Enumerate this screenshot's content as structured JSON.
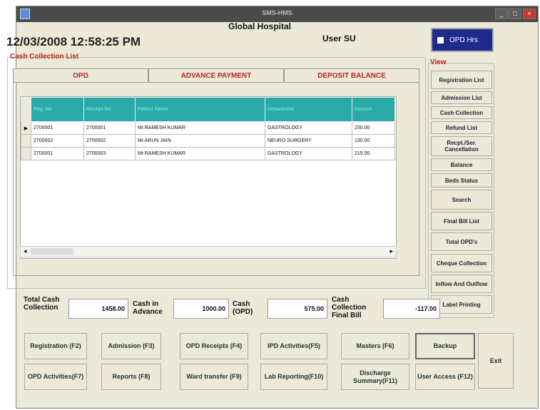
{
  "window": {
    "title": "SMS-HMS",
    "min_glyph": "_",
    "max_glyph": "□",
    "close_glyph": "×"
  },
  "header": {
    "datetime": "12/03/2008 12:58:25 PM",
    "hospital": "Global Hospital",
    "user": "User SU",
    "opd_hrs": "OPD Hrs"
  },
  "cash_list": {
    "title": "Cash Collection List",
    "tabs": [
      "OPD",
      "ADVANCE PAYMENT",
      "DEPOSIT BALANCE"
    ],
    "columns": [
      "Reg. No",
      "Receipt No",
      "Patient Name",
      "Department",
      "Amount"
    ],
    "rows": [
      [
        "2700001",
        "2700001",
        "Mr.RAMESH KUMAR",
        "GASTROLOGY",
        "230.00"
      ],
      [
        "2700002",
        "2700002",
        "Mr.ARUN JAIN",
        "NEURO SURGERY",
        "130.00"
      ],
      [
        "2700001",
        "2700003",
        "Mr.RAMESH KUMAR",
        "GASTROLOGY",
        "215.00"
      ]
    ],
    "current_row_marker": "▶",
    "scroll_left": "◂",
    "scroll_right": "▸"
  },
  "view": {
    "title": "View",
    "buttons": [
      "Registration List",
      "Admission List",
      "Cash Collection",
      "Refund List",
      "Recpt./Ser. Cancellation",
      "Balance",
      "Beds Status",
      "Search",
      "Final Bill List",
      "Total OPD's",
      "Cheque Collection",
      "Inflow And Outflow",
      "Label Printing"
    ]
  },
  "summary": {
    "total_label": "Total Cash Collection",
    "total_value": "1458.00",
    "advance_label": "Cash in Advance",
    "advance_value": "1000.00",
    "opd_label": "Cash (OPD)",
    "opd_value": "575.00",
    "final_label": "Cash Collection Final Bill",
    "final_value": "-117.00"
  },
  "functions": {
    "registration": "Registration (F2)",
    "admission": "Admission (F3)",
    "opd_receipts": "OPD Receipts (F4)",
    "ipd_activities": "IPD Activities(F5)",
    "masters": "Masters (F6)",
    "backup": "Backup",
    "exit": "Exit",
    "opd_activities": "OPD Activities(F7)",
    "reports": "Reports (F8)",
    "ward_transfer": "Ward transfer (F9)",
    "lab_reporting": "Lab Reporting(F10)",
    "discharge": "Discharge Summary(F11)",
    "user_access": "User Access (F12)"
  }
}
